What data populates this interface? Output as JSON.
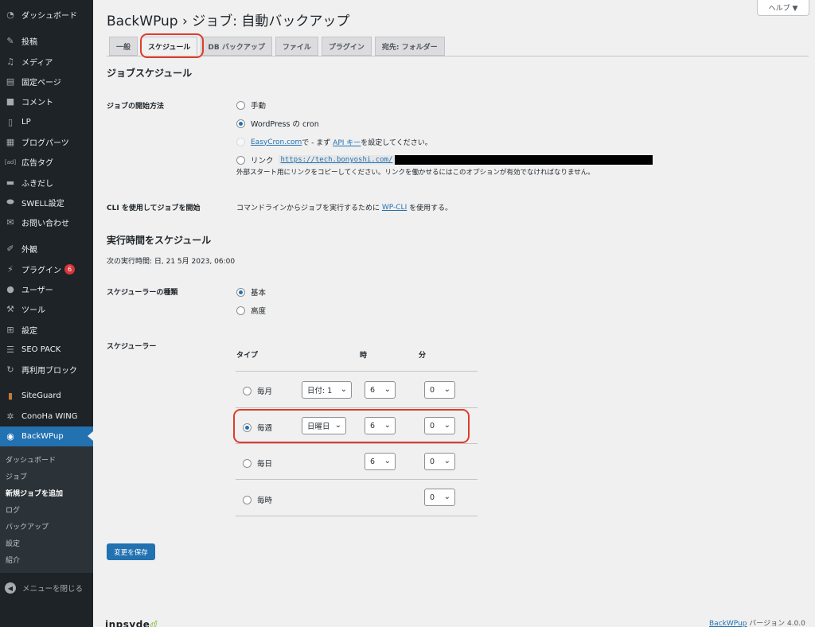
{
  "sidebar": {
    "items": [
      {
        "label": "ダッシュボード",
        "icon": "dashboard-icon"
      },
      {
        "label": "投稿",
        "icon": "pin-icon"
      },
      {
        "label": "メディア",
        "icon": "media-icon"
      },
      {
        "label": "固定ページ",
        "icon": "page-icon"
      },
      {
        "label": "コメント",
        "icon": "comment-icon"
      },
      {
        "label": "LP",
        "icon": "document-icon"
      },
      {
        "label": "ブログパーツ",
        "icon": "blogparts-icon"
      },
      {
        "label": "広告タグ",
        "icon": "ad-icon"
      },
      {
        "label": "ふきだし",
        "icon": "balloon-icon"
      },
      {
        "label": "SWELL設定",
        "icon": "toggle-icon"
      },
      {
        "label": "お問い合わせ",
        "icon": "mail-icon"
      },
      {
        "label": "外観",
        "icon": "brush-icon"
      },
      {
        "label": "プラグイン",
        "icon": "plugin-icon",
        "badge": "6"
      },
      {
        "label": "ユーザー",
        "icon": "user-icon"
      },
      {
        "label": "ツール",
        "icon": "wrench-icon"
      },
      {
        "label": "設定",
        "icon": "settings-icon"
      },
      {
        "label": "SEO PACK",
        "icon": "list-icon"
      },
      {
        "label": "再利用ブロック",
        "icon": "reuse-icon"
      },
      {
        "label": "SiteGuard",
        "icon": "siteguard-icon"
      },
      {
        "label": "ConoHa WING",
        "icon": "gear-icon"
      },
      {
        "label": "BackWPup",
        "icon": "backwpup-icon"
      }
    ],
    "submenu": [
      "ダッシュボード",
      "ジョブ",
      "新規ジョブを追加",
      "ログ",
      "バックアップ",
      "設定",
      "紹介"
    ],
    "collapse_label": "メニューを閉じる"
  },
  "help_label": "ヘルプ ▼",
  "page_title": "BackWPup › ジョブ: 自動バックアップ",
  "tabs": [
    "一般",
    "スケジュール",
    "DB バックアップ",
    "ファイル",
    "プラグイン",
    "宛先: フォルダー"
  ],
  "schedule": {
    "heading": "ジョブスケジュール",
    "start_label": "ジョブの開始方法",
    "start_options": {
      "manual": "手動",
      "wpcron": "WordPress の cron",
      "easycron_link": "EasyCron.com",
      "easycron_mid": "で - まず",
      "easycron_api": "API キー",
      "easycron_tail": "を設定してください。",
      "link": "リンク",
      "link_url": "https://tech.bonyoshi.com/"
    },
    "link_desc": "外部スタート用にリンクをコピーしてください。リンクを働かせるにはこのオプションが有効でなければなりません。",
    "cli_label": "CLI を使用してジョブを開始",
    "cli_text_pre": "コマンドラインからジョブを実行するために",
    "cli_link": "WP-CLI",
    "cli_text_post": "を使用する。"
  },
  "exec": {
    "heading": "実行時間をスケジュール",
    "next_run": "次の実行時間: 日, 21 5月 2023, 06:00",
    "type_label": "スケジューラーの種類",
    "type_basic": "基本",
    "type_advanced": "高度",
    "scheduler_label": "スケジューラー",
    "col_type": "タイプ",
    "col_hour": "時",
    "col_min": "分",
    "rows": [
      {
        "label": "毎月",
        "day": "日付: 1",
        "hour": "6",
        "min": "0"
      },
      {
        "label": "毎週",
        "day": "日曜日",
        "hour": "6",
        "min": "0"
      },
      {
        "label": "毎日",
        "hour": "6",
        "min": "0"
      },
      {
        "label": "毎時",
        "min": "0"
      }
    ]
  },
  "save_label": "変更を保存",
  "footer": {
    "logo": "inpsyde",
    "plugin_link": "BackWPup",
    "version": " バージョン 4.0.0"
  },
  "colors": {
    "accent": "#2271b1",
    "highlight": "#e03c2a",
    "sidebar": "#1d2327"
  }
}
